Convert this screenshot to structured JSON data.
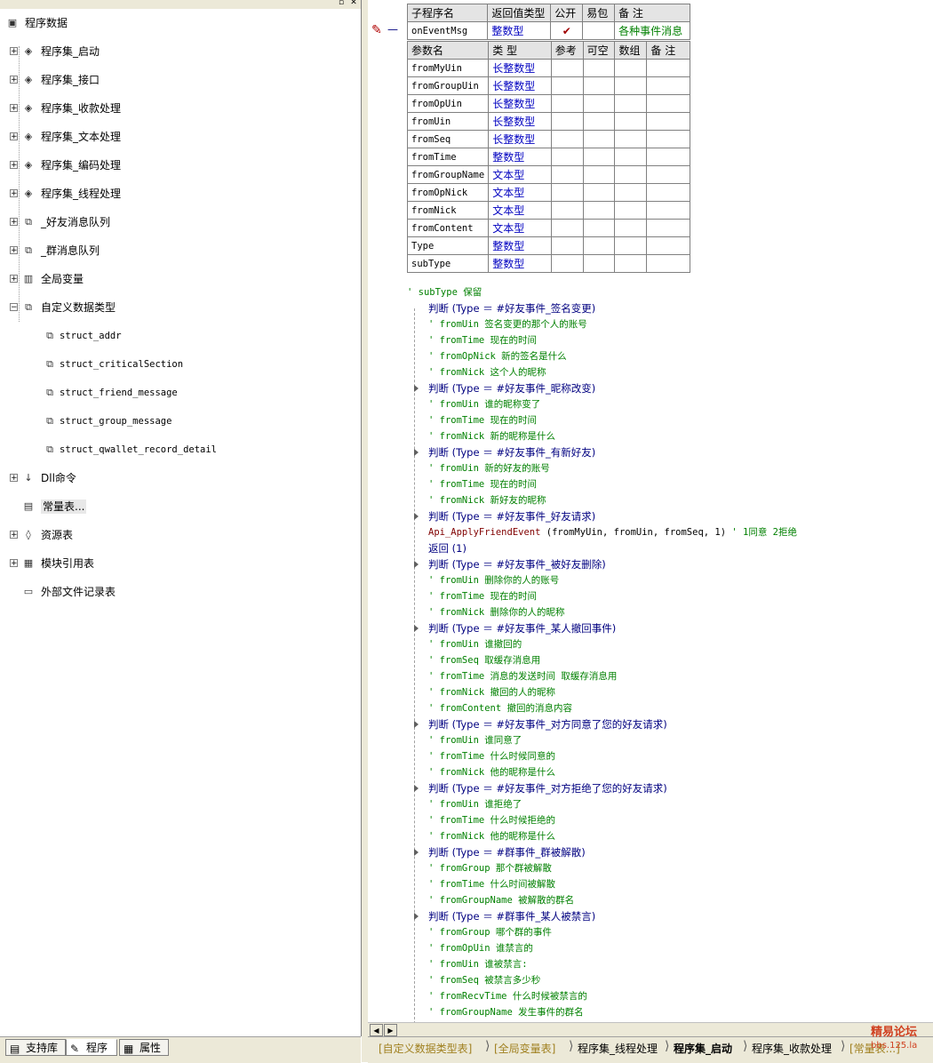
{
  "tree": {
    "root": "程序数据",
    "items": [
      {
        "label": "程序集_启动",
        "icon": "module-icon"
      },
      {
        "label": "程序集_接口",
        "icon": "module-icon"
      },
      {
        "label": "程序集_收款处理",
        "icon": "module-icon"
      },
      {
        "label": "程序集_文本处理",
        "icon": "module-icon"
      },
      {
        "label": "程序集_编码处理",
        "icon": "module-icon"
      },
      {
        "label": "程序集_线程处理",
        "icon": "module-icon"
      },
      {
        "label": "_好友消息队列",
        "icon": "class-icon"
      },
      {
        "label": "_群消息队列",
        "icon": "class-icon"
      },
      {
        "label": "全局变量",
        "icon": "database-icon"
      },
      {
        "label": "自定义数据类型",
        "icon": "struct-icon"
      }
    ],
    "structs": [
      "struct_addr",
      "struct_criticalSection",
      "struct_friend_message",
      "struct_group_message",
      "struct_qwallet_record_detail"
    ],
    "after": [
      {
        "label": "Dll命令",
        "icon": "dll-icon"
      },
      {
        "label": "常量表...",
        "icon": "constant-icon"
      },
      {
        "label": "资源表",
        "icon": "resource-icon"
      },
      {
        "label": "模块引用表",
        "icon": "module-ref-icon"
      },
      {
        "label": "外部文件记录表",
        "icon": "file-icon"
      }
    ]
  },
  "left_tabs": [
    "支持库",
    "程序",
    "属性"
  ],
  "sub_header": {
    "cols": [
      "子程序名",
      "返回值类型",
      "公开",
      "易包",
      "备 注"
    ],
    "name": "onEventMsg",
    "ret_type": "整数型",
    "public_mark": "✔",
    "remark": "各种事件消息"
  },
  "param_header": [
    "参数名",
    "类 型",
    "参考",
    "可空",
    "数组",
    "备 注"
  ],
  "params": [
    {
      "name": "fromMyUin",
      "type": "长整数型"
    },
    {
      "name": "fromGroupUin",
      "type": "长整数型"
    },
    {
      "name": "fromOpUin",
      "type": "长整数型"
    },
    {
      "name": "fromUin",
      "type": "长整数型"
    },
    {
      "name": "fromSeq",
      "type": "长整数型"
    },
    {
      "name": "fromTime",
      "type": "整数型"
    },
    {
      "name": "fromGroupName",
      "type": "文本型"
    },
    {
      "name": "fromOpNick",
      "type": "文本型"
    },
    {
      "name": "fromNick",
      "type": "文本型"
    },
    {
      "name": "fromContent",
      "type": "文本型"
    },
    {
      "name": "Type",
      "type": "整数型"
    },
    {
      "name": "subType",
      "type": "整数型"
    }
  ],
  "code": {
    "l0": "' subType  保留",
    "j1": "判断 (Type ＝ #好友事件_签名变更)",
    "c1a": "' fromUin  签名变更的那个人的账号",
    "c1b": "' fromTime 现在的时间",
    "c1c": "' fromOpNick 新的签名是什么",
    "c1d": "' fromNick 这个人的昵称",
    "j2": "判断 (Type ＝ #好友事件_昵称改变)",
    "c2a": "' fromUin  谁的昵称变了",
    "c2b": "' fromTime 现在的时间",
    "c2c": "' fromNick 新的昵称是什么",
    "j3": "判断 (Type ＝ #好友事件_有新好友)",
    "c3a": "' fromUin 新的好友的账号",
    "c3b": "' fromTime 现在的时间",
    "c3c": "' fromNick 新好友的昵称",
    "j4": "判断 (Type ＝ #好友事件_好友请求)",
    "call_fn": "Api_ApplyFriendEvent",
    "call_args": " (fromMyUin, fromUin, fromSeq, 1) ",
    "call_cmt": "' 1同意 2拒绝",
    "ret": "返回 (1)",
    "j5": "判断 (Type ＝ #好友事件_被好友删除)",
    "c5a": "' fromUin  删除你的人的账号",
    "c5b": "' fromTime 现在的时间",
    "c5c": "' fromNick 删除你的人的昵称",
    "j6": "判断 (Type ＝ #好友事件_某人撤回事件)",
    "c6a": "' fromUin  谁撤回的",
    "c6b": "' fromSeq  取缓存消息用",
    "c6c": "' fromTime 消息的发送时间 取缓存消息用",
    "c6d": "' fromNick 撤回的人的昵称",
    "c6e": "' fromContent 撤回的消息内容",
    "j7": "判断 (Type ＝ #好友事件_对方同意了您的好友请求)",
    "c7a": "' fromUin 谁同意了",
    "c7b": "' fromTime 什么时候同意的",
    "c7c": "' fromNick 他的昵称是什么",
    "j8": "判断 (Type ＝ #好友事件_对方拒绝了您的好友请求)",
    "c8a": "' fromUin 谁拒绝了",
    "c8b": "' fromTime 什么时候拒绝的",
    "c8c": "' fromNick 他的昵称是什么",
    "j9": "判断 (Type ＝ #群事件_群被解散)",
    "c9a": "' fromGroup 那个群被解散",
    "c9b": "' fromTime  什么时间被解散",
    "c9c": "' fromGroupName 被解散的群名",
    "j10": "判断 (Type ＝ #群事件_某人被禁言)",
    "c10a": "' fromGroup 哪个群的事件",
    "c10b": "' fromOpUin 谁禁言的",
    "c10c": "' fromUin   谁被禁言:",
    "c10d": "' fromSeq   被禁言多少秒",
    "c10e": "' fromRecvTime 什么时候被禁言的",
    "c10f": "' fromGroupName 发生事件的群名"
  },
  "bottom_tabs": [
    "[自定义数据类型表]",
    "[全局变量表]",
    "程序集_线程处理",
    "程序集_启动",
    "程序集_收款处理",
    "[常量表...]"
  ],
  "watermark": {
    "line1": "精易论坛",
    "line2": "bbs.125.la"
  }
}
